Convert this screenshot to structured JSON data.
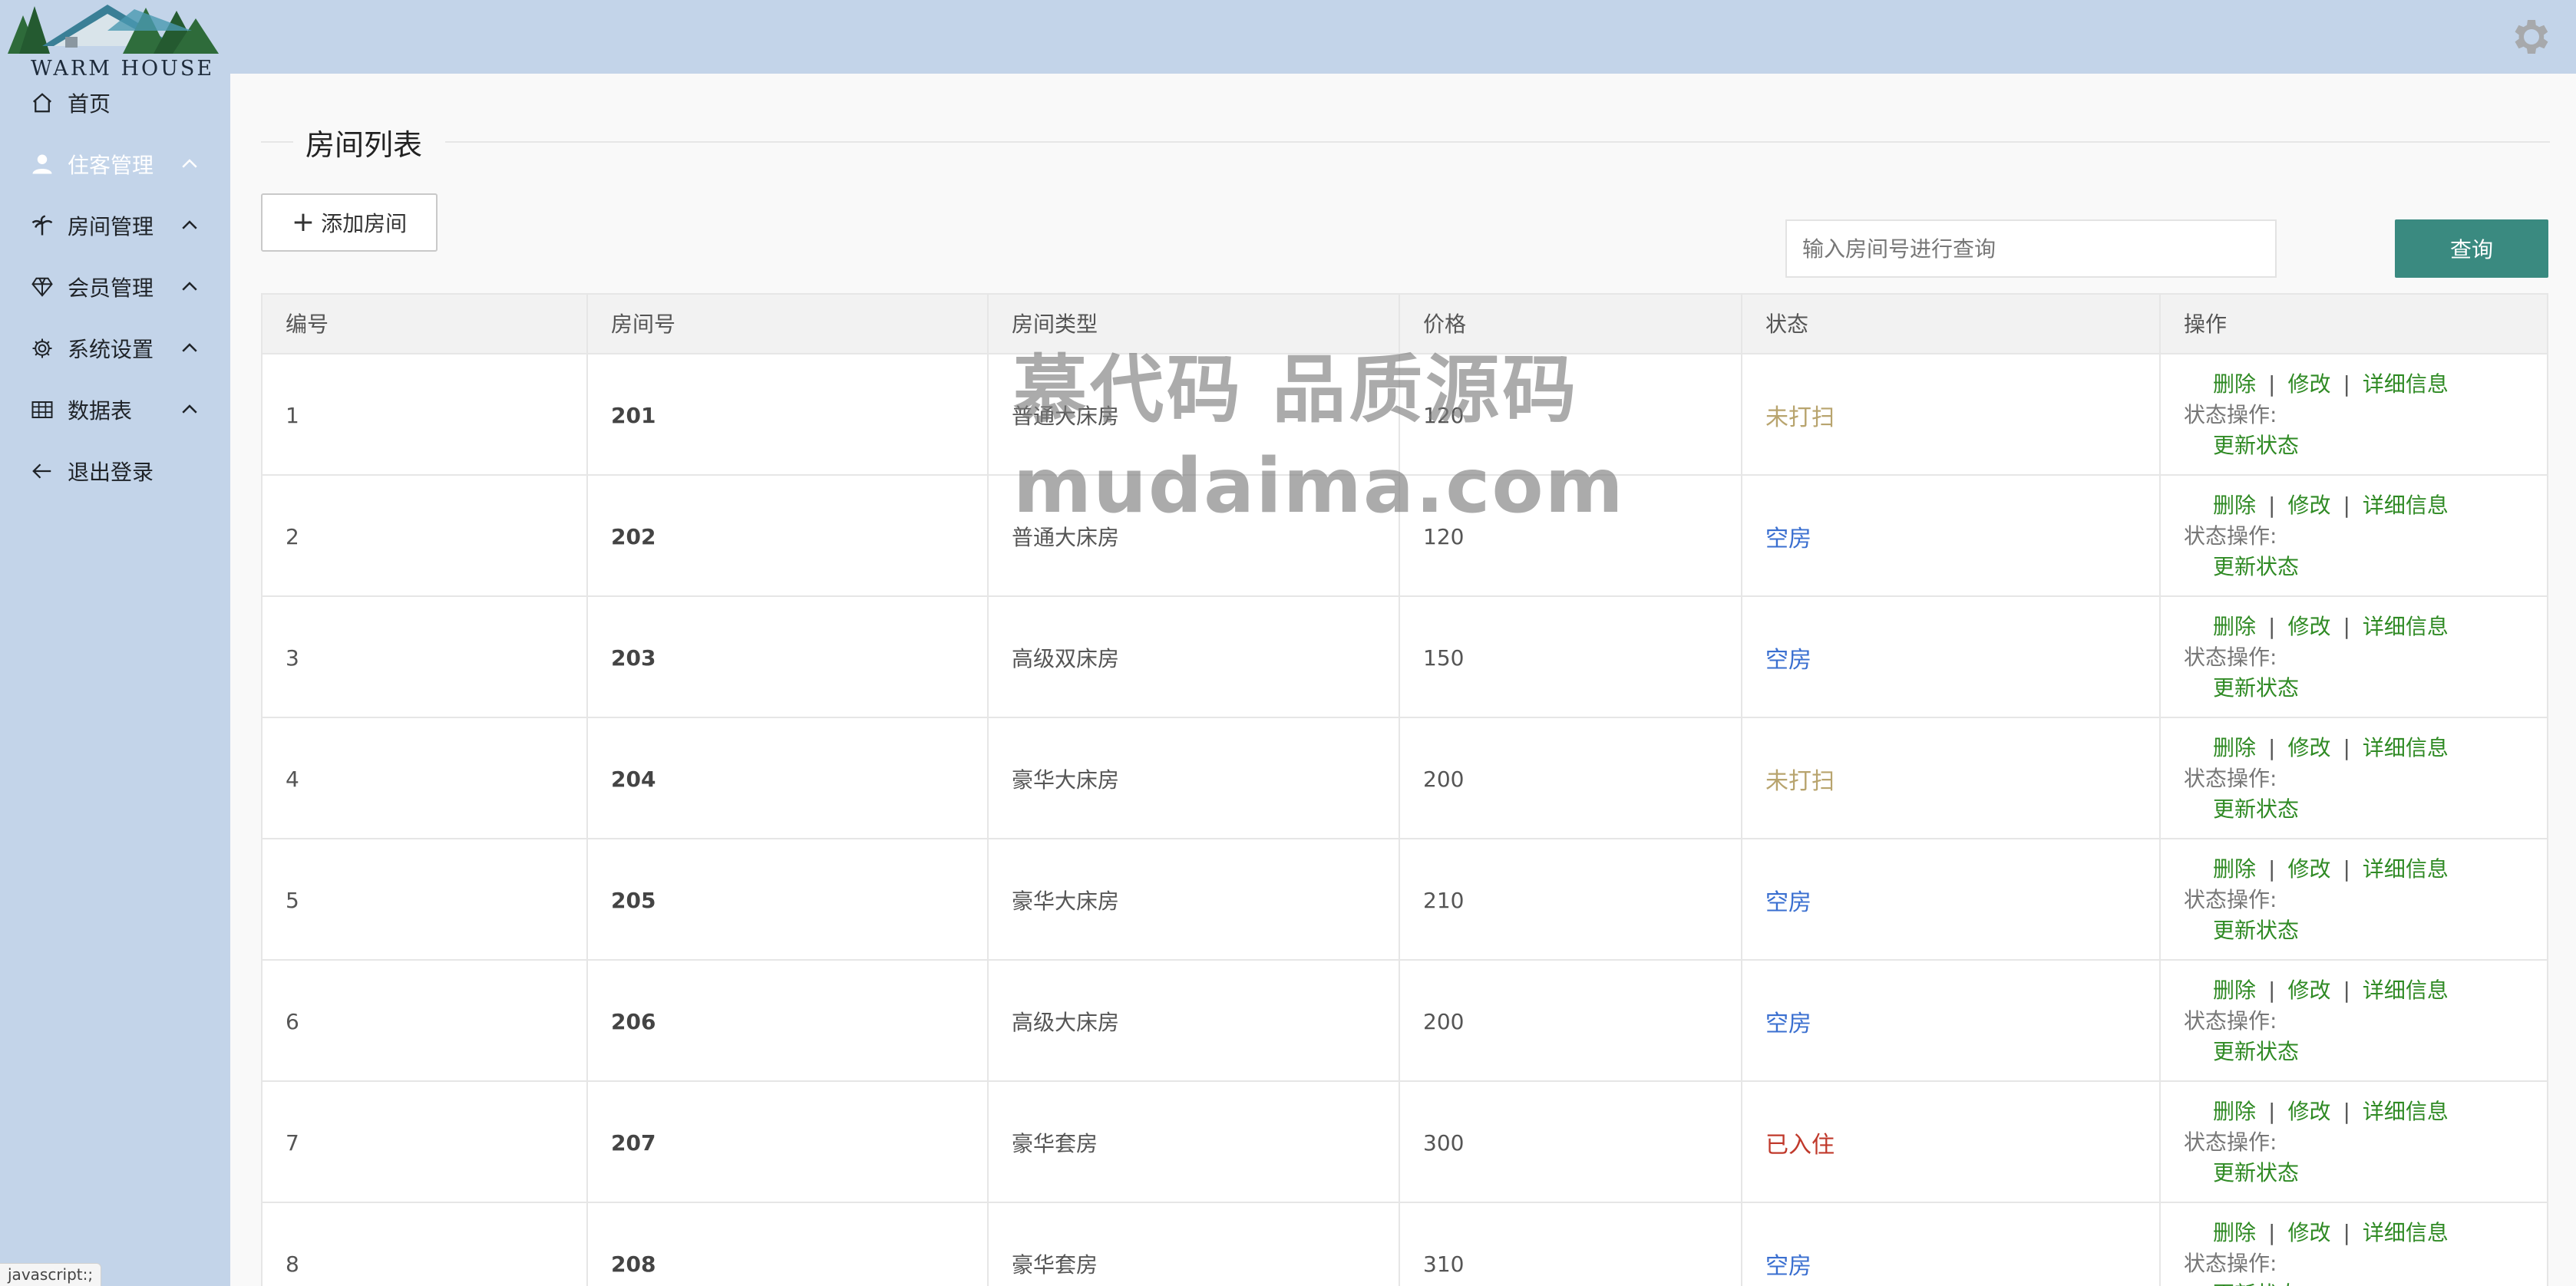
{
  "app": {
    "logo_text": "WARM HOUSE"
  },
  "sidebar": {
    "items": [
      {
        "label": "首页",
        "icon": "home-icon",
        "has_chevron": false,
        "active": false
      },
      {
        "label": "住客管理",
        "icon": "user-icon",
        "has_chevron": true,
        "active": true
      },
      {
        "label": "房间管理",
        "icon": "palm-tree-icon",
        "has_chevron": true,
        "active": false
      },
      {
        "label": "会员管理",
        "icon": "diamond-icon",
        "has_chevron": true,
        "active": false
      },
      {
        "label": "系统设置",
        "icon": "gear-icon",
        "has_chevron": true,
        "active": false
      },
      {
        "label": "数据表",
        "icon": "table-icon",
        "has_chevron": true,
        "active": false
      },
      {
        "label": "退出登录",
        "icon": "arrow-left-icon",
        "has_chevron": false,
        "active": false
      }
    ]
  },
  "main": {
    "title": "房间列表",
    "add_button_label": "添加房间",
    "search": {
      "placeholder": "输入房间号进行查询",
      "value": "",
      "button_label": "查询"
    }
  },
  "table": {
    "columns": [
      "编号",
      "房间号",
      "房间类型",
      "价格",
      "状态",
      "操作"
    ],
    "rows": [
      {
        "id": "1",
        "room": "201",
        "type": "普通大床房",
        "price": "120",
        "status": "未打扫",
        "status_color": "#b8a46e"
      },
      {
        "id": "2",
        "room": "202",
        "type": "普通大床房",
        "price": "120",
        "status": "空房",
        "status_color": "#3a6fd0"
      },
      {
        "id": "3",
        "room": "203",
        "type": "高级双床房",
        "price": "150",
        "status": "空房",
        "status_color": "#3a6fd0"
      },
      {
        "id": "4",
        "room": "204",
        "type": "豪华大床房",
        "price": "200",
        "status": "未打扫",
        "status_color": "#b8a46e"
      },
      {
        "id": "5",
        "room": "205",
        "type": "豪华大床房",
        "price": "210",
        "status": "空房",
        "status_color": "#3a6fd0"
      },
      {
        "id": "6",
        "room": "206",
        "type": "高级大床房",
        "price": "200",
        "status": "空房",
        "status_color": "#3a6fd0"
      },
      {
        "id": "7",
        "room": "207",
        "type": "豪华套房",
        "price": "300",
        "status": "已入住",
        "status_color": "#c0392b"
      },
      {
        "id": "8",
        "room": "208",
        "type": "豪华套房",
        "price": "310",
        "status": "空房",
        "status_color": "#3a6fd0"
      }
    ],
    "ops": {
      "delete": "删除",
      "edit": "修改",
      "detail": "详细信息",
      "status_label": "状态操作:",
      "update": "更新状态",
      "separator": "|"
    }
  },
  "watermark": {
    "line1": "慕代码 品质源码",
    "line2": "mudaima.com"
  },
  "statusbar": {
    "url": "javascript:;"
  },
  "colors": {
    "sidebar_bg": "#c3d4e9",
    "accent_button": "#3a8a80",
    "link_green": "#2f8a24"
  }
}
